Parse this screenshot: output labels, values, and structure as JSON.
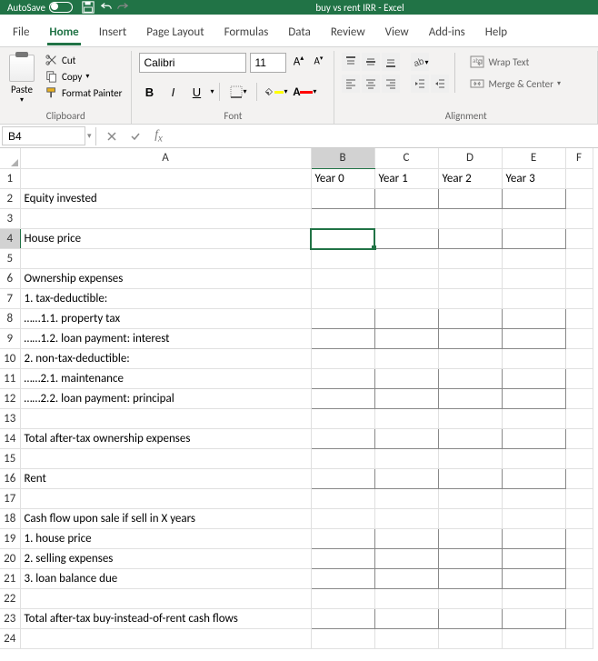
{
  "titlebar": {
    "autosave_label": "AutoSave",
    "title": "buy vs rent IRR - Excel"
  },
  "tabs": {
    "file": "File",
    "home": "Home",
    "insert": "Insert",
    "page_layout": "Page Layout",
    "formulas": "Formulas",
    "data": "Data",
    "review": "Review",
    "view": "View",
    "addins": "Add-ins",
    "help": "Help"
  },
  "ribbon": {
    "clipboard": {
      "paste": "Paste",
      "cut": "Cut",
      "copy": "Copy",
      "format_painter": "Format Painter",
      "group_label": "Clipboard"
    },
    "font": {
      "name": "Calibri",
      "size": "11",
      "group_label": "Font"
    },
    "alignment": {
      "wrap_text": "Wrap Text",
      "merge_center": "Merge & Center",
      "group_label": "Alignment"
    }
  },
  "namebox": "B4",
  "formula": "",
  "columns": {
    "A": "A",
    "B": "B",
    "C": "C",
    "D": "D",
    "E": "E",
    "F": "F"
  },
  "cells": {
    "B1": "Year 0",
    "C1": "Year 1",
    "D1": "Year 2",
    "E1": "Year 3",
    "A2": "Equity invested",
    "A4": "House price",
    "A6": "Ownership expenses",
    "A7": "1. tax-deductible:",
    "A8": "……1.1. property tax",
    "A9": "……1.2. loan payment: interest",
    "A10": "2. non-tax-deductible:",
    "A11": "……2.1. maintenance",
    "A12": "……2.2. loan payment: principal",
    "A14": "Total after-tax ownership expenses",
    "A16": "Rent",
    "A18": "Cash flow upon sale if sell in X years",
    "A19": "1. house price",
    "A20": "2. selling expenses",
    "A21": "3. loan balance due",
    "A23": "Total after-tax buy-instead-of-rent cash flows"
  },
  "row_count": 24
}
